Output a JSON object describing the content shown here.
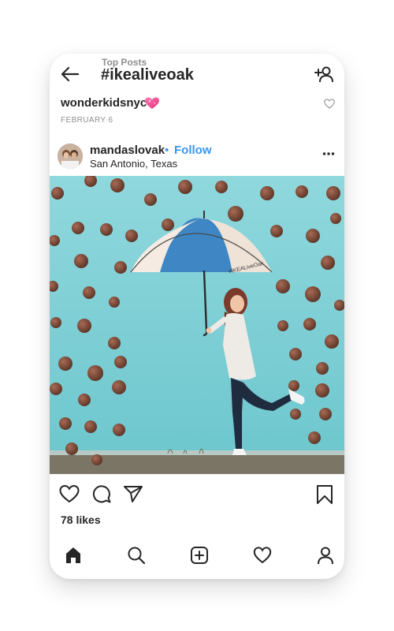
{
  "header": {
    "subtitle": "Top Posts",
    "title": "#ikealiveoak"
  },
  "previous_post": {
    "username": "wonderkidsnyc",
    "date": "FEBRUARY 6"
  },
  "post": {
    "username": "mandaslovak",
    "separator": "•",
    "follow_label": "Follow",
    "location": "San Antonio, Texas",
    "umbrella_text": "#IKEALiveOak",
    "likes": "78 likes"
  },
  "icons": {
    "back": "arrow-left-icon",
    "add_user": "add-user-icon",
    "emoji": "sparkling-heart-icon",
    "more": "more-horizontal-icon",
    "like": "heart-icon",
    "comment": "comment-icon",
    "share": "send-icon",
    "save": "bookmark-icon",
    "nav": [
      "home-icon",
      "search-icon",
      "new-post-icon",
      "activity-heart-icon",
      "profile-icon"
    ]
  },
  "colors": {
    "link_blue": "#3897f0",
    "text": "#262626",
    "muted": "#8e8e8e",
    "wall": "#7dd0d6"
  }
}
